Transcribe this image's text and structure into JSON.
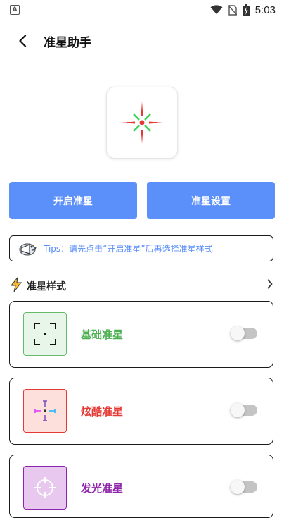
{
  "status_bar": {
    "time": "5:03",
    "left_icon": "A"
  },
  "app_bar": {
    "title": "准星助手",
    "back_icon": "chevron-left-icon"
  },
  "actions": {
    "start_label": "开启准星",
    "settings_label": "准星设置"
  },
  "tips": {
    "text": "Tips：请先点击“开启准星”后再选择准星样式"
  },
  "section": {
    "title": "准星样式"
  },
  "styles": [
    {
      "label": "基础准星",
      "label_color": "#4caf50",
      "thumb_bg": "#e8f5e9",
      "thumb_border": "#66bb6a",
      "enabled": false
    },
    {
      "label": "炫酷准星",
      "label_color": "#e53935",
      "thumb_bg": "#fde0dc",
      "thumb_border": "#e53935",
      "enabled": false
    },
    {
      "label": "发光准星",
      "label_color": "#8e24aa",
      "thumb_bg": "#e8c8ee",
      "thumb_border": "#8e24aa",
      "enabled": false
    }
  ],
  "colors": {
    "accent": "#5b8ff9",
    "toggle_off": "#c4c4c4"
  }
}
